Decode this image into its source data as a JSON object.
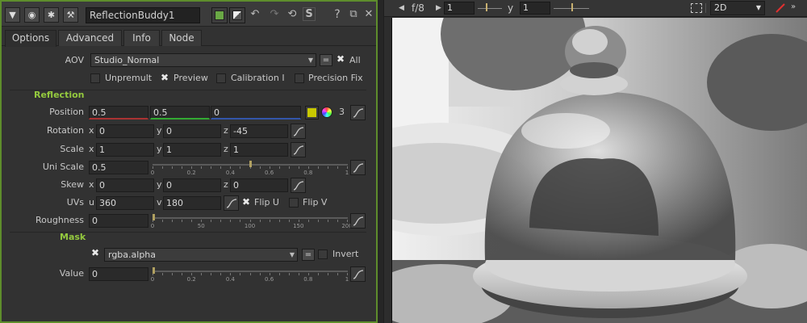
{
  "header": {
    "node_name": "ReflectionBuddy1",
    "settings_label": "S"
  },
  "tabs": [
    "Options",
    "Advanced",
    "Info",
    "Node"
  ],
  "aov": {
    "label": "AOV",
    "value": "Studio_Normal",
    "eq": "=",
    "all_label": "All",
    "checks": [
      {
        "label": "Unpremult",
        "checked": false
      },
      {
        "label": "Preview",
        "checked": true
      },
      {
        "label": "Calibration I",
        "checked": false
      },
      {
        "label": "Precision Fix",
        "checked": false
      }
    ]
  },
  "reflection": {
    "title": "Reflection",
    "position": {
      "label": "Position",
      "x": "0.5",
      "y": "0.5",
      "z": "0",
      "count": "3"
    },
    "rotation": {
      "label": "Rotation",
      "x": "0",
      "y": "0",
      "z": "-45"
    },
    "scale": {
      "label": "Scale",
      "x": "1",
      "y": "1",
      "z": "1"
    },
    "uni_scale": {
      "label": "Uni Scale",
      "value": "0.5",
      "level": 0.5,
      "ticks": [
        "0",
        "0.2",
        "0.4",
        "0.6",
        "0.8",
        "1"
      ]
    },
    "skew": {
      "label": "Skew",
      "x": "0",
      "y": "0",
      "z": "0"
    },
    "uvs": {
      "label": "UVs",
      "u": "360",
      "v": "180",
      "flip_u": "Flip U",
      "flip_u_checked": true,
      "flip_v": "Flip V",
      "flip_v_checked": false
    },
    "roughness": {
      "label": "Roughness",
      "value": "0",
      "level": 0,
      "ticks": [
        "0",
        "50",
        "100",
        "150",
        "200"
      ]
    }
  },
  "mask": {
    "title": "Mask",
    "channel": "rgba.alpha",
    "enabled": true,
    "eq": "=",
    "invert_label": "Invert",
    "value": {
      "label": "Value",
      "value": "0",
      "level": 0,
      "ticks": [
        "0",
        "0.2",
        "0.4",
        "0.6",
        "0.8",
        "1"
      ]
    }
  },
  "axes": {
    "x": "x",
    "y": "y",
    "z": "z",
    "u": "u",
    "v": "v"
  },
  "viewer": {
    "fstop": "f/8",
    "frame_value": "1",
    "gamma_label": "y",
    "gamma_value": "1",
    "view_mode": "2D"
  },
  "colors": {
    "accent_green": "#94c93e",
    "panel_border": "#5e8d2c",
    "swatch_yellow": "#c8c800"
  }
}
